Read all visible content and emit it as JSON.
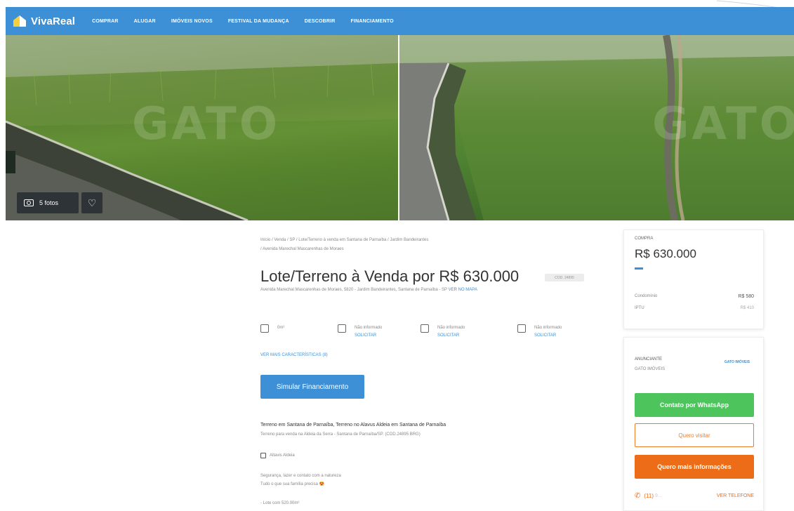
{
  "header": {
    "logo_text": "VivaReal",
    "nav": [
      "COMPRAR",
      "ALUGAR",
      "IMÓVEIS NOVOS",
      "FESTIVAL DA MUDANÇA",
      "DESCOBRIR",
      "FINANCIAMENTO"
    ]
  },
  "gallery": {
    "watermark": "GATO",
    "photos_label": "5 fotos"
  },
  "listing": {
    "breadcrumb_line1": "Início / Venda / SP / Lote/Terreno à venda em Santana de Parnaíba / Jardim Bandeirantes",
    "breadcrumb_line2": "/ Avenida Marechal Mascarenhas de Moraes",
    "title": "Lote/Terreno à Venda por R$ 630.000",
    "code": "COD. 24895",
    "address": "Avenida Marechal Mascarenhas de Moraes, 5820 - Jardim Bandeirantes, Santana de Parnaíba - SP",
    "map_link": "VER NO MAPA",
    "features": [
      {
        "icon": "area-icon",
        "text": "0m²",
        "link": ""
      },
      {
        "icon": "bed-icon",
        "text": "Não informado",
        "link": "SOLICITAR"
      },
      {
        "icon": "bath-icon",
        "text": "Não informado",
        "link": "SOLICITAR"
      },
      {
        "icon": "car-icon",
        "text": "Não informado",
        "link": "SOLICITAR"
      }
    ],
    "more_features": "VER MAIS CARACTERÍSTICAS (8)",
    "simulate_button": "Simular Financiamento",
    "description_title": "Terreno em Santana de Parnaíba, Terreno no Alavus Aldeia em Santana de Parnaíba",
    "description_sub": "Terreno para venda na Aldeia da Serra - Santana de Parnaíba/SP. (COD.24895 BRG)",
    "place": "Altavis Aldeia",
    "desc_lines": [
      "Segurança, lazer e contato com a natureza",
      "Tudo o que sua família precisa 😍",
      "- Lote com 520.00m²"
    ]
  },
  "price_card": {
    "label": "COMPRA",
    "price": "R$ 630.000",
    "fees": [
      {
        "label": "Condomínio",
        "value": "R$ 580"
      },
      {
        "label": "IPTU",
        "value": "R$ 410"
      }
    ]
  },
  "contact_card": {
    "advertiser_label": "ANUNCIANTE",
    "advertiser_name": "GATO IMÓVEIS",
    "logo_text": "GATO IMÓVEIS",
    "whatsapp_button": "Contato por WhatsApp",
    "visit_button": "Quero visitar",
    "info_button": "Quero mais informações",
    "phone": "(11)",
    "phone_hidden": "9...",
    "phone_link": "VER TELEFONE"
  },
  "colors": {
    "brand_blue": "#3d8fd6",
    "whatsapp_green": "#4ec45c",
    "orange": "#ec6c17"
  }
}
